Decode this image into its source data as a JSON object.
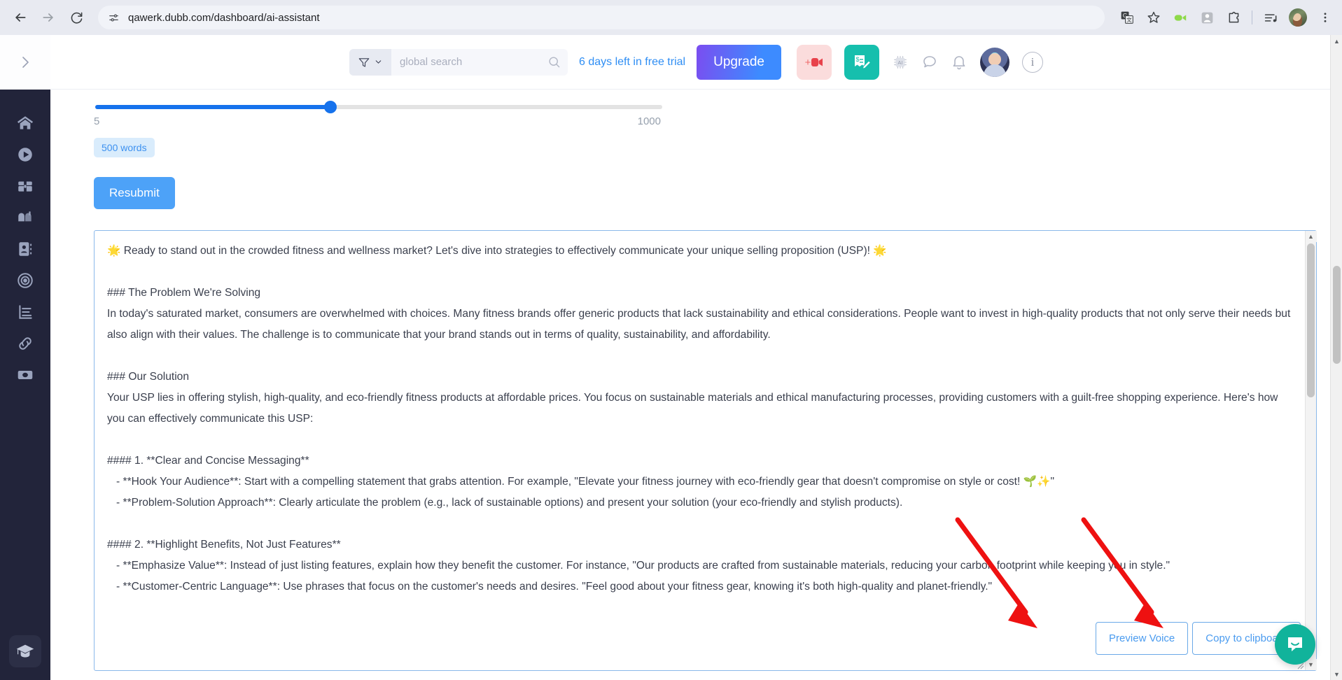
{
  "browser": {
    "back_label": "back-navigation",
    "forward_label": "forward-navigation",
    "reload_label": "reload-page",
    "url": "qawerk.dubb.com/dashboard/ai-assistant",
    "site_info_icon": "tune-icon",
    "bookmark_icon": "star-icon",
    "extensions": [
      {
        "name": "google-translate-icon"
      },
      {
        "name": "video-recorder-icon"
      },
      {
        "name": "screenshot-extension-icon"
      },
      {
        "name": "extensions-puzzle-icon"
      },
      {
        "name": "media-playlist-icon"
      },
      {
        "name": "chrome-profile-avatar"
      },
      {
        "name": "chrome-menu-icon"
      }
    ]
  },
  "app_header": {
    "sidebar_toggle_icon": "chevron-right-icon",
    "search": {
      "placeholder": "global search",
      "value": "",
      "filter_icon": "filter-funnel-icon",
      "filter_chevron_icon": "chevron-down-icon",
      "search_icon": "search-icon"
    },
    "trial_notice": "6 days left in free trial",
    "upgrade_label": "Upgrade",
    "icons": [
      {
        "name": "add-video-icon"
      },
      {
        "name": "create-invoice-icon"
      },
      {
        "name": "ai-chip-icon"
      },
      {
        "name": "chat-bubble-icon"
      },
      {
        "name": "notifications-bell-icon"
      },
      {
        "name": "user-avatar"
      },
      {
        "name": "info-icon"
      }
    ],
    "info_glyph": "i"
  },
  "sidebar": {
    "items": [
      {
        "name": "sidebar-item-home",
        "icon": "home-icon"
      },
      {
        "name": "sidebar-item-videos",
        "icon": "play-circle-icon"
      },
      {
        "name": "sidebar-item-library",
        "icon": "treasure-chest-icon"
      },
      {
        "name": "sidebar-item-mailbox",
        "icon": "mailbox-icon"
      },
      {
        "name": "sidebar-item-contacts",
        "icon": "contacts-book-icon"
      },
      {
        "name": "sidebar-item-campaigns",
        "icon": "target-icon"
      },
      {
        "name": "sidebar-item-reports",
        "icon": "bar-chart-icon"
      },
      {
        "name": "sidebar-item-links",
        "icon": "link-chain-icon"
      },
      {
        "name": "sidebar-item-billing",
        "icon": "money-bill-icon"
      }
    ],
    "bottom_item": {
      "name": "sidebar-item-academy",
      "icon": "graduation-cap-icon"
    }
  },
  "main": {
    "slider": {
      "min_label": "5",
      "max_label": "1000",
      "value": 500,
      "percent": 41.5,
      "chip_label": "500 words"
    },
    "resubmit_label": "Resubmit",
    "output": {
      "text": "🌟 Ready to stand out in the crowded fitness and wellness market? Let's dive into strategies to effectively communicate your unique selling proposition (USP)! 🌟\n\n### The Problem We're Solving\nIn today's saturated market, consumers are overwhelmed with choices. Many fitness brands offer generic products that lack sustainability and ethical considerations. People want to invest in high-quality products that not only serve their needs but also align with their values. The challenge is to communicate that your brand stands out in terms of quality, sustainability, and affordability.\n\n### Our Solution\nYour USP lies in offering stylish, high-quality, and eco-friendly fitness products at affordable prices. You focus on sustainable materials and ethical manufacturing processes, providing customers with a guilt-free shopping experience. Here's how you can effectively communicate this USP:\n\n#### 1. **Clear and Concise Messaging**\n   - **Hook Your Audience**: Start with a compelling statement that grabs attention. For example, \"Elevate your fitness journey with eco-friendly gear that doesn't compromise on style or cost! 🌱✨\"\n   - **Problem-Solution Approach**: Clearly articulate the problem (e.g., lack of sustainable options) and present your solution (your eco-friendly and stylish products).\n\n#### 2. **Highlight Benefits, Not Just Features**\n   - **Emphasize Value**: Instead of just listing features, explain how they benefit the customer. For instance, \"Our products are crafted from sustainable materials, reducing your carbon footprint while keeping you in style.\"\n   - **Customer-Centric Language**: Use phrases that focus on the customer's needs and desires. \"Feel good about your fitness gear, knowing it's both high-quality and planet-friendly.\"",
      "preview_voice_label": "Preview Voice",
      "copy_clipboard_label": "Copy to clipboard",
      "scroll_up_icon": "scroll-up-arrow-icon",
      "scroll_down_icon": "scroll-down-arrow-icon",
      "resize_icon": "resize-grip-icon"
    }
  },
  "widgets": {
    "intercom_label": "intercom-chat-icon"
  },
  "colors": {
    "accent_blue": "#4da2f8",
    "link_blue": "#2f8ef4",
    "sidebar_bg": "#22243a",
    "teal": "#16bfad",
    "upgrade_gradient_start": "#7b4df0",
    "upgrade_gradient_end": "#3d8bff",
    "annotation_red": "#ee1111"
  }
}
